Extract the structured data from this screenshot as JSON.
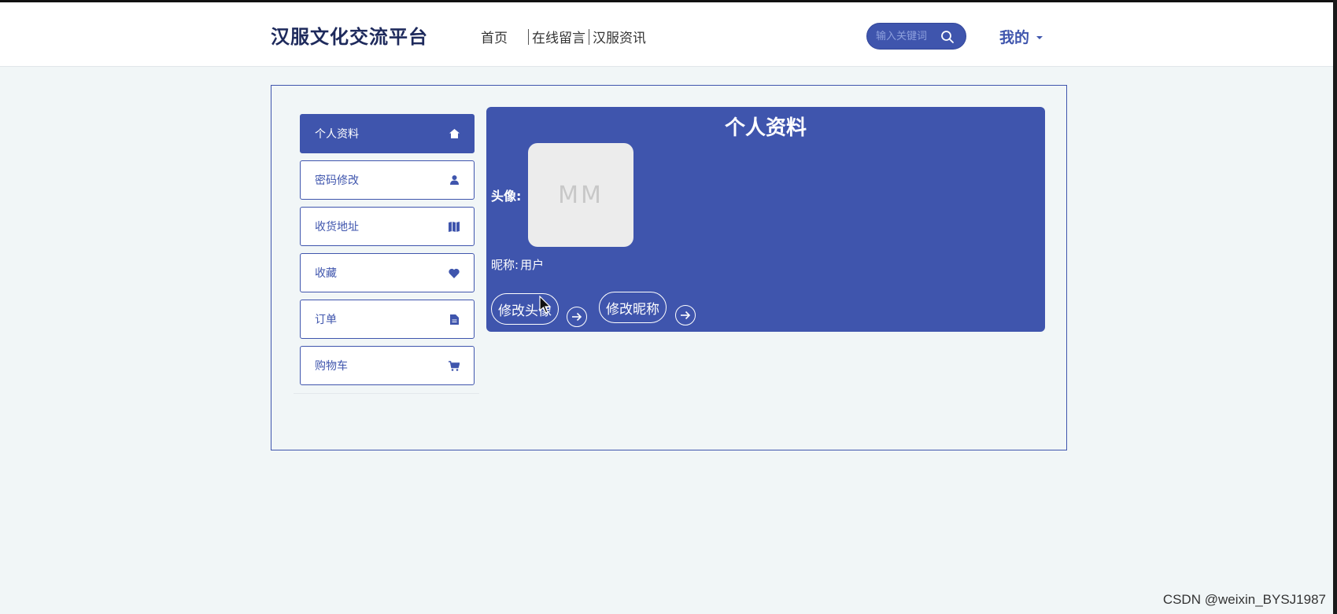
{
  "header": {
    "logo": "汉服文化交流平台",
    "nav": [
      "首页",
      "在线留言",
      "汉服资讯"
    ],
    "search_placeholder": "输入关键词",
    "user_menu": "我的"
  },
  "sidebar": {
    "items": [
      {
        "label": "个人资料",
        "icon": "home-icon",
        "active": true
      },
      {
        "label": "密码修改",
        "icon": "user-icon",
        "active": false
      },
      {
        "label": "收货地址",
        "icon": "map-icon",
        "active": false
      },
      {
        "label": "收藏",
        "icon": "heart-icon",
        "active": false
      },
      {
        "label": "订单",
        "icon": "file-icon",
        "active": false
      },
      {
        "label": "购物车",
        "icon": "cart-icon",
        "active": false
      }
    ]
  },
  "panel": {
    "title": "个人资料",
    "avatar_label": "头像:",
    "avatar_placeholder": "MM",
    "nickname_label": "昵称:",
    "nickname_value": "用户",
    "buttons": {
      "change_avatar": "修改头像",
      "change_nickname": "修改昵称"
    }
  },
  "watermark": "CSDN @weixin_BYSJ1987",
  "colors": {
    "accent": "#3f55ad",
    "page_bg": "#f1f6f7",
    "logo": "#1e2a5c"
  }
}
